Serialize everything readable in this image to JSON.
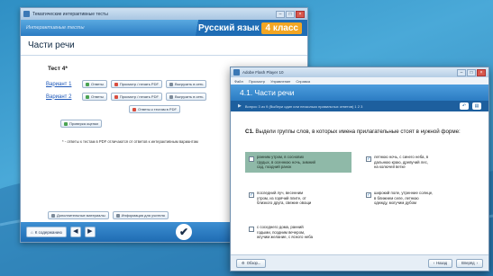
{
  "back_window": {
    "title_bar": "Тематические интерактивные тесты",
    "banner_left": "Интерактивные тесты",
    "subject": "Русский язык",
    "grade": "4 класс",
    "heading": "Части речи",
    "test_title": "Тест 4*",
    "rows": [
      {
        "variant": "Вариант 1",
        "answers": "Ответы",
        "print": "Просмотр / печать PDF",
        "export": "Выгрузить в сеть"
      },
      {
        "variant": "Вариант 2",
        "answers": "Ответы",
        "print": "Просмотр / печать PDF",
        "export": "Выгрузить в сеть"
      }
    ],
    "extra_button": "Ответы к тестам в PDF",
    "check_button": "Проверка оценки",
    "note": "* - ответы к тестам в PDF отличаются от ответов к интерактивным вариантам",
    "bottom_links": [
      "Дополнительные материалы",
      "Информация для учителя"
    ],
    "contents_button": "К содержанию",
    "logo_glyph": "✔"
  },
  "front_window": {
    "title_bar": "Adobe Flash Player 10",
    "menu": [
      "Файл",
      "Просмотр",
      "Управление",
      "Справка"
    ],
    "header": "4.1. Части речи",
    "toolbar_text": "Вопрос 3 из 9 (Выбери один или несколько правильных ответов) 1 2 3",
    "question_id": "С1.",
    "question_text": "Выдели группы слов, в которых имена прилагательные стоят в нужной форме:",
    "options": [
      {
        "text": "ранним утром, в соснових\nгрудых, в осеннюю ночь, зимний\nсад, поздний ранок",
        "checked": false,
        "selected": true
      },
      {
        "text": "летнюю ночь, с синего неба, в\nдальнюю краю, древучий лес,\nна колючей ветке",
        "checked": true,
        "selected": false
      },
      {
        "text": "последний луч, весенним\nутром, из горячий плите, от\nблизкого друга, свежие овощи",
        "checked": true,
        "selected": false
      },
      {
        "text": "широкий поле, утренние солнце,\nв ближнем селе, летнюю\nодежду, могучим дубом",
        "checked": true,
        "selected": false
      },
      {
        "text": "с соседнего дома, ранний\nгодыми, поздним вечером,\nжгучим желание, с ясного неба",
        "checked": false,
        "selected": false
      }
    ],
    "footer": {
      "back": "Обзор...",
      "prev": "Назад",
      "next": "Вперёд"
    }
  }
}
